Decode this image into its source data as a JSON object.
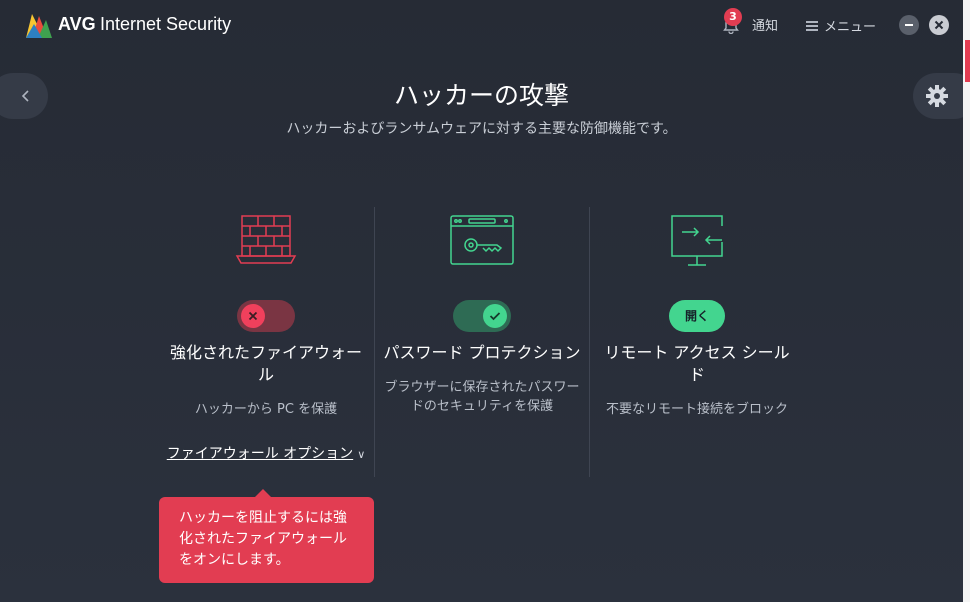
{
  "app": {
    "brand": "AVG",
    "product": "Internet Security"
  },
  "header": {
    "notification_count": "3",
    "notification_label": "通知",
    "menu_label": "メニュー"
  },
  "page": {
    "title": "ハッカーの攻撃",
    "subtitle": "ハッカーおよびランサムウェアに対する主要な防御機能です。"
  },
  "features": [
    {
      "name": "強化されたファイアウォール",
      "description": "ハッカーから PC を保護",
      "state": "off",
      "link": "ファイアウォール オプション",
      "icon": "firewall-icon"
    },
    {
      "name": "パスワード プロテクション",
      "description": "ブラウザーに保存されたパスワードのセキュリティを保護",
      "state": "on",
      "icon": "password-key-icon"
    },
    {
      "name": "リモート アクセス シールド",
      "description": "不要なリモート接続をブロック",
      "button": "開く",
      "icon": "remote-access-icon"
    }
  ],
  "tooltip": {
    "text": "ハッカーを阻止するには強化されたファイアウォールをオンにします。"
  },
  "colors": {
    "accent_red": "#e23d52",
    "accent_green": "#43d58f",
    "background": "#262b35"
  }
}
